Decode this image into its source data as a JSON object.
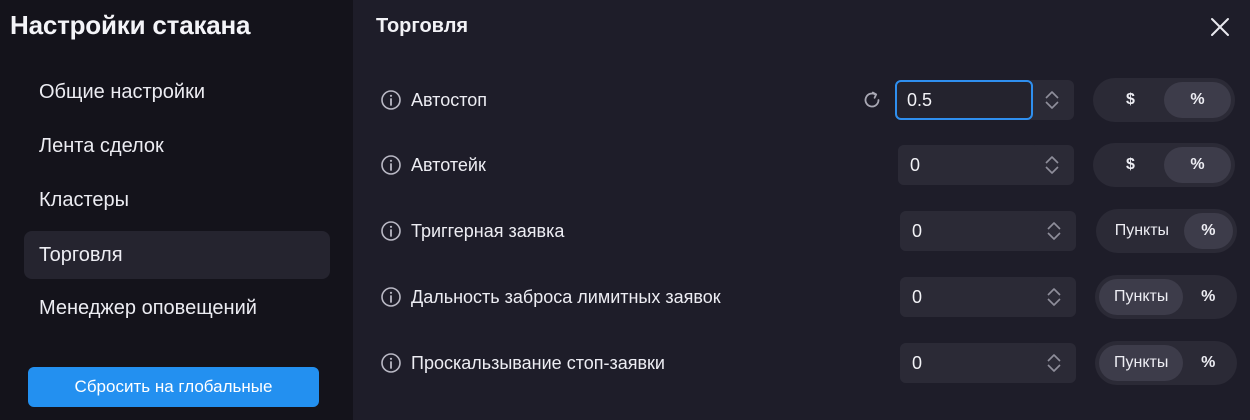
{
  "sidebar": {
    "title": "Настройки стакана",
    "items": [
      {
        "label": "Общие настройки"
      },
      {
        "label": "Лента сделок"
      },
      {
        "label": "Кластеры"
      },
      {
        "label": "Торговля"
      },
      {
        "label": "Менеджер оповещений"
      }
    ],
    "active_item": "Торговля",
    "reset_label": "Сбросить на глобальные"
  },
  "main": {
    "title": "Торговля",
    "rows": [
      {
        "label": "Автостоп",
        "value": "0.5",
        "toggle": [
          "$",
          "%"
        ],
        "selected": "%"
      },
      {
        "label": "Автотейк",
        "value": "0",
        "toggle": [
          "$",
          "%"
        ],
        "selected": "%"
      },
      {
        "label": "Триггерная заявка",
        "value": "0",
        "toggle": [
          "Пункты",
          "%"
        ],
        "selected": "%"
      },
      {
        "label": "Дальность заброса лимитных заявок",
        "value": "0",
        "toggle": [
          "Пункты",
          "%"
        ],
        "selected": "Пункты"
      },
      {
        "label": "Проскальзывание стоп-заявки",
        "value": "0",
        "toggle": [
          "Пункты",
          "%"
        ],
        "selected": "Пункты"
      }
    ]
  },
  "colors": {
    "accent": "#2390f0",
    "focus_border": "#2f8fef",
    "sidebar_bg": "#14131b",
    "main_bg": "#1e1d29",
    "field_bg": "#2b2a36",
    "active_segment": "#3d3c4a"
  },
  "icons": {
    "close": "close-icon",
    "info": "info-icon",
    "refresh": "refresh-icon",
    "stepper": "stepper-icon"
  }
}
